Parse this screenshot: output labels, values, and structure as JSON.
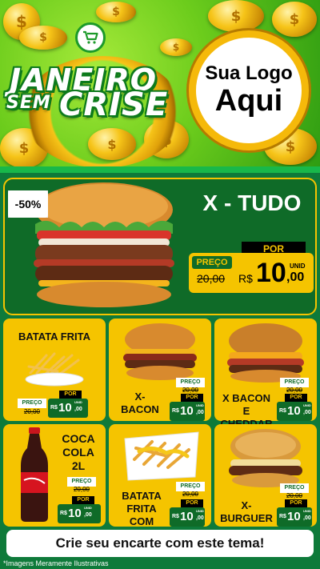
{
  "header": {
    "title_line1": "JANEIRO",
    "title_line2": "SEM",
    "title_line3": "CRISE",
    "logo_line1": "Sua Logo",
    "logo_line2": "Aqui",
    "cart_icon": "shopping-cart-icon"
  },
  "featured": {
    "discount": "-50%",
    "name": "X - TUDO",
    "por_label": "POR",
    "preco_label": "PREÇO",
    "old_price": "20,00",
    "currency": "R$",
    "price_int": "10",
    "price_cents": ",00",
    "unit": "UNID"
  },
  "products": [
    {
      "name": "BATATA FRITA",
      "preco_label": "PREÇO",
      "old_price": "20,00",
      "por_label": "POR",
      "currency": "R$",
      "price_int": "10",
      "price_cents": ",00",
      "unit": "UNID"
    },
    {
      "name": "X-BACON",
      "preco_label": "PREÇO",
      "old_price": "20,00",
      "por_label": "POR",
      "currency": "R$",
      "price_int": "10",
      "price_cents": ",00",
      "unit": "UNID"
    },
    {
      "name": "X BACON E CHEDDAR",
      "preco_label": "PREÇO",
      "old_price": "20,00",
      "por_label": "POR",
      "currency": "R$",
      "price_int": "10",
      "price_cents": ",00",
      "unit": "UNID"
    },
    {
      "name": "COCA COLA 2L",
      "preco_label": "PREÇO",
      "old_price": "20,00",
      "por_label": "POR",
      "currency": "R$",
      "price_int": "10",
      "price_cents": ",00",
      "unit": "UNID"
    },
    {
      "name": "BATATA FRITA COM CHEDDAR",
      "preco_label": "PREÇO",
      "old_price": "20,00",
      "por_label": "POR",
      "currency": "R$",
      "price_int": "10",
      "price_cents": ",00",
      "unit": "UNID"
    },
    {
      "name": "X-BURGUER",
      "preco_label": "PREÇO",
      "old_price": "20,00",
      "por_label": "POR",
      "currency": "R$",
      "price_int": "10",
      "price_cents": ",00",
      "unit": "UNID"
    }
  ],
  "footer": {
    "cta": "Crie seu encarte com este tema!",
    "disclaimer": "*Imagens Meramente Ilustrativas"
  },
  "colors": {
    "brand_green": "#0f6b28",
    "accent_yellow": "#f5c400",
    "header_green": "#6ccc1c"
  }
}
